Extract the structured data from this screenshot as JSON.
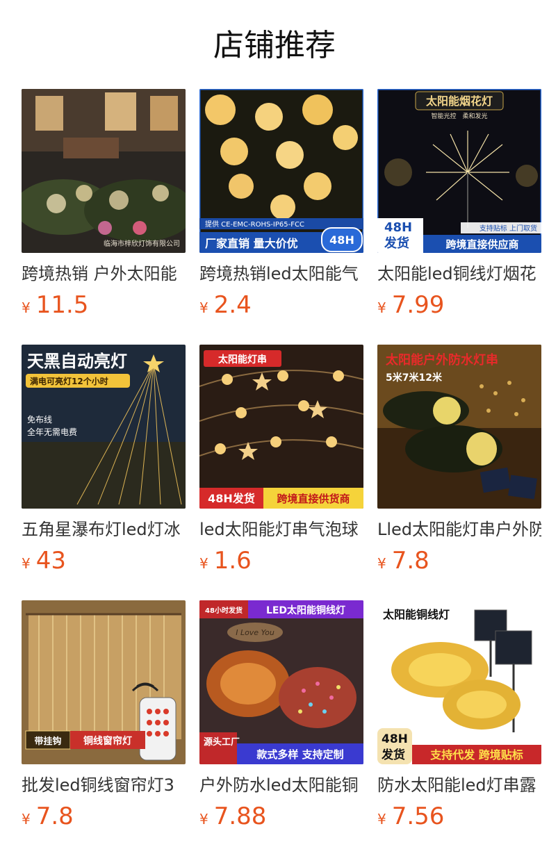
{
  "page": {
    "title": "店铺推荐"
  },
  "currency": "¥",
  "colors": {
    "price": "#e8541e",
    "title": "#111111",
    "name": "#333333"
  },
  "products": [
    {
      "name": "跨境热销 户外太阳能",
      "price": "11.5",
      "image_text": {
        "watermark": "临海市梓欣灯饰有限公司"
      }
    },
    {
      "name": "跨境热销led太阳能气",
      "price": "2.4",
      "image_text": {
        "cert": "提供 CE-EMC-ROHS-IP65-FCC",
        "banner": "厂家直销 量大价优",
        "badge": "48H"
      }
    },
    {
      "name": "太阳能led铜线灯烟花",
      "price": "7.99",
      "image_text": {
        "title": "太阳能烟花灯",
        "sub": "智能光控　柔和发光",
        "badge_top": "48H",
        "badge_bottom": "发货",
        "note": "支持贴标 上门取货",
        "banner": "跨境直接供应商"
      }
    },
    {
      "name": "五角星瀑布灯led灯冰",
      "price": "43",
      "image_text": {
        "headline": "天黑自动亮灯",
        "sub": "满电可亮灯12个小时",
        "note1": "免布线",
        "note2": "全年无需电费"
      }
    },
    {
      "name": "led太阳能灯串气泡球",
      "price": "1.6",
      "image_text": {
        "tag": "太阳能灯串",
        "badge": "48H发货",
        "banner": "跨境直接供货商"
      }
    },
    {
      "name": "Lled太阳能灯串户外防",
      "price": "7.8",
      "image_text": {
        "headline": "太阳能户外防水灯串",
        "sub": "5米7米12米"
      }
    },
    {
      "name": "批发led铜线窗帘灯3",
      "price": "7.8",
      "image_text": {
        "tag": "带挂钩",
        "banner": "铜线窗帘灯"
      }
    },
    {
      "name": "户外防水led太阳能铜",
      "price": "7.88",
      "image_text": {
        "tag": "48小时发货",
        "headline": "LED太阳能铜线灯",
        "script": "I Love You",
        "corner": "源头工厂",
        "banner": "款式多样 支持定制"
      }
    },
    {
      "name": "防水太阳能led灯串露",
      "price": "7.56",
      "image_text": {
        "headline": "太阳能铜线灯",
        "badge_top": "48H",
        "badge_bottom": "发货",
        "banner": "支持代发 跨境贴标"
      }
    }
  ]
}
